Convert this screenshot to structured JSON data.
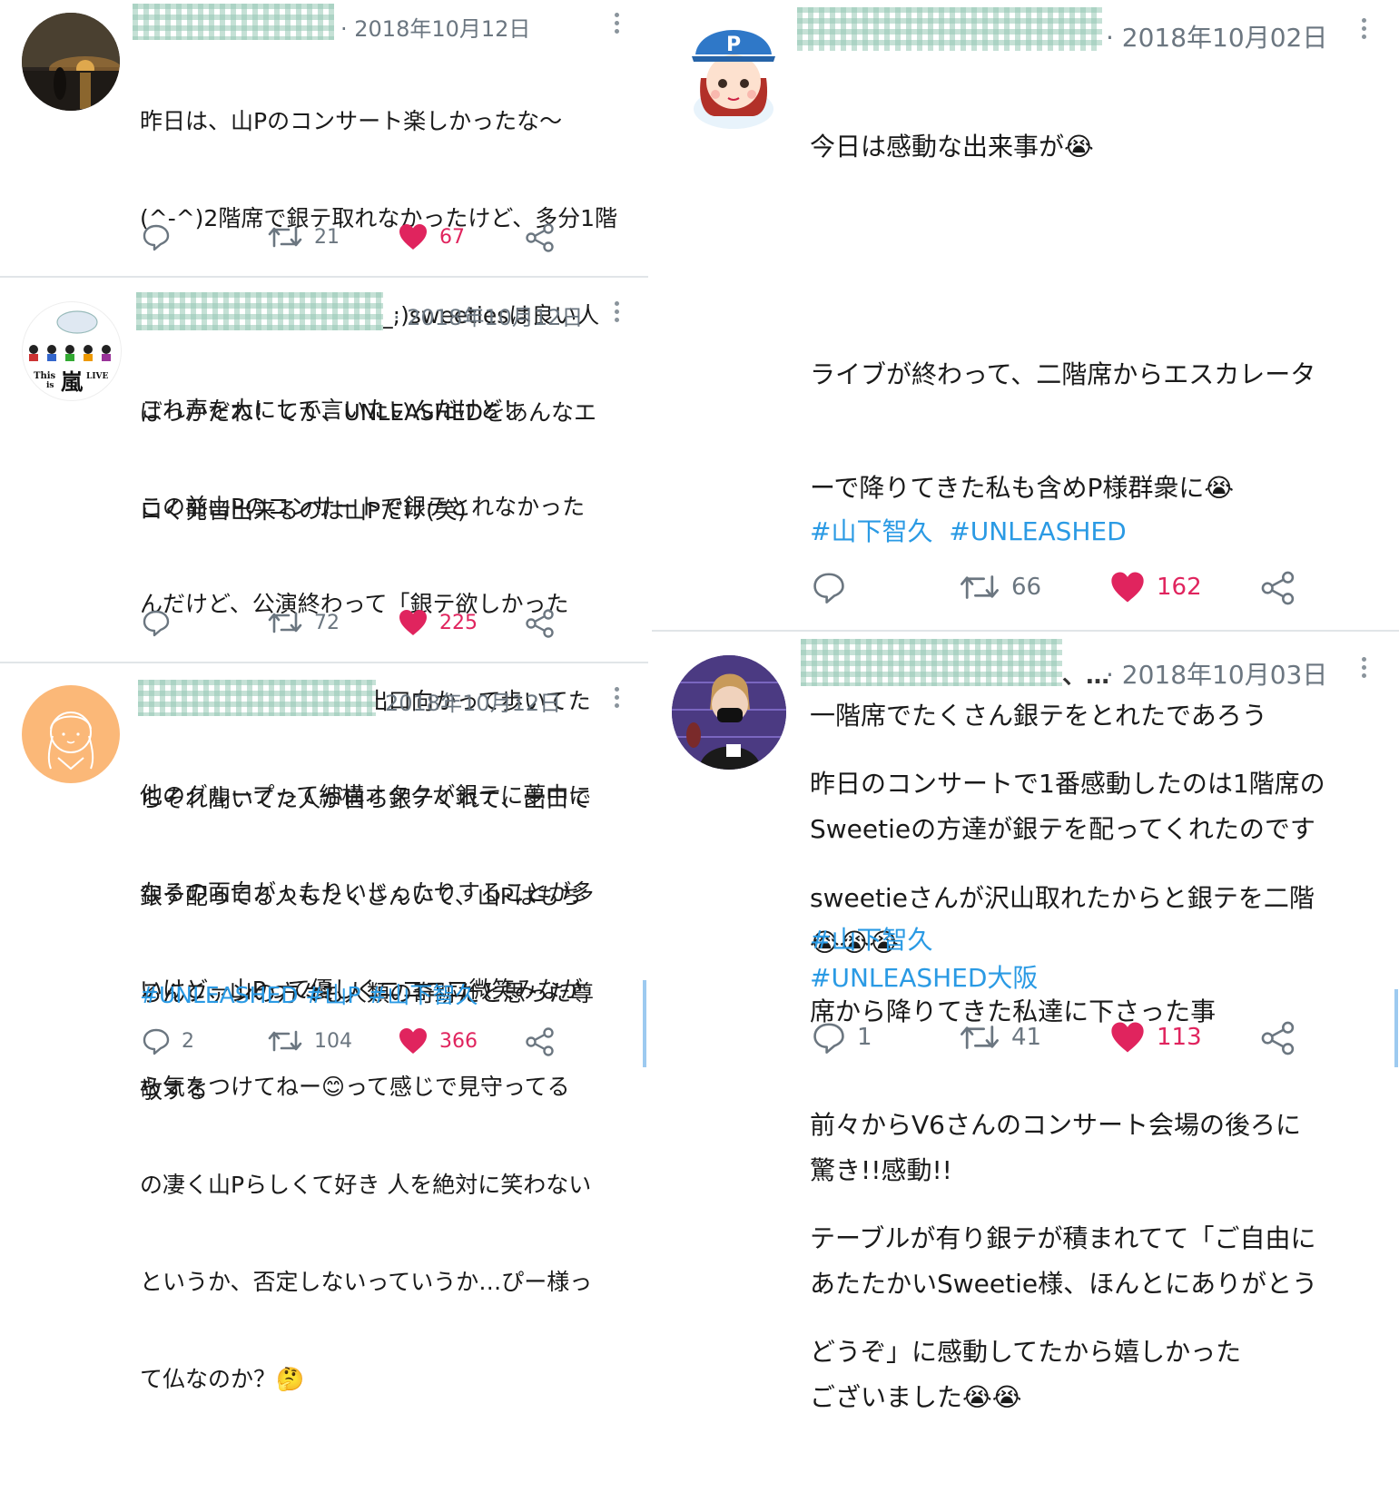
{
  "tweets": [
    {
      "date": "· 2018年10月12日",
      "lines": [
        "昨日は、山Pのコンサート楽しかったな〜",
        "(^-^)2階席で銀テ取れなかったけど、多分1階",
        "席の人が譲ってくれた(;_;)sweetiesは良い人",
        "ばっかだね！てか、UNLEASHEDをあんなエ",
        "ロく発音出来るのは山Pだけ(笑)"
      ],
      "tags": "",
      "replies": "",
      "retweets": "21",
      "likes": "67"
    },
    {
      "date": "· 2018年10月12日",
      "lines": [
        "これ声を大にして言いたいんだけど！",
        "この前山Pのコンサートで銀テとれなかった",
        "んだけど、公演終わって「銀テ欲しかった",
        "ね〜」って言いながら出口向かって歩いてた",
        "らそれ聞いてた人が自ら銀テくれて、出口で",
        "銀テ配ってる人もたくさんいて、山Pはもち",
        "ろんファンの方々も人類の奇跡だと思った尊",
        "敬する"
      ],
      "tags": "",
      "replies": "",
      "retweets": "72",
      "likes": "225",
      "avatar_text": [
        "This",
        "嵐",
        "LIVE",
        "is"
      ]
    },
    {
      "date": "2018年10月12日",
      "lines": [
        "他のグループって結構オタクが銀テに夢中に",
        "なるの面白がったりいじったりすることが多",
        "いけど、山Pって優しくニコニコ微笑みなが",
        "ら気をつけてねー😊って感じで見守ってる",
        "の凄く山Pらしくて好き 人を絶対に笑わない",
        "というか、否定しないっていうか…ぴー様っ",
        "て仏なのか？🤔"
      ],
      "tags": "#UNLEASHED #山P #山下智久",
      "replies": "2",
      "retweets": "104",
      "likes": "366"
    },
    {
      "date": "· 2018年10月02日",
      "lines": [
        "今日は感動な出来事が😭",
        "",
        "ライブが終わって、二階席からエスカレータ",
        "ーで降りてきた私も含めP様群衆に😭",
        "",
        "一階席でたくさん銀テをとれたであろう",
        "Sweetieの方達が銀テを配ってくれたのです",
        "😭😭😭",
        "",
        "驚き!!感動!!",
        "あたたかいSweetie様、ほんとにありがとう",
        "ございました😭😭"
      ],
      "tags": "#山下智久  #UNLEASHED",
      "replies": "",
      "retweets": "66",
      "likes": "162",
      "avatar_text": "P"
    },
    {
      "date": "· 2018年10月03日",
      "prefix": "、…",
      "lines": [
        "昨日のコンサートで1番感動したのは1階席の",
        "sweetieさんが沢山取れたからと銀テを二階",
        "席から降りてきた私達に下さった事",
        "前々からV6さんのコンサート会場の後ろに",
        "テーブルが有り銀テが積まれてて「ご自由に",
        "どうぞ」に感動してたから嬉しかった"
      ],
      "tags": "#山下智久",
      "tags2": "#UNLEASHED大阪",
      "replies": "1",
      "retweets": "41",
      "likes": "113"
    }
  ]
}
